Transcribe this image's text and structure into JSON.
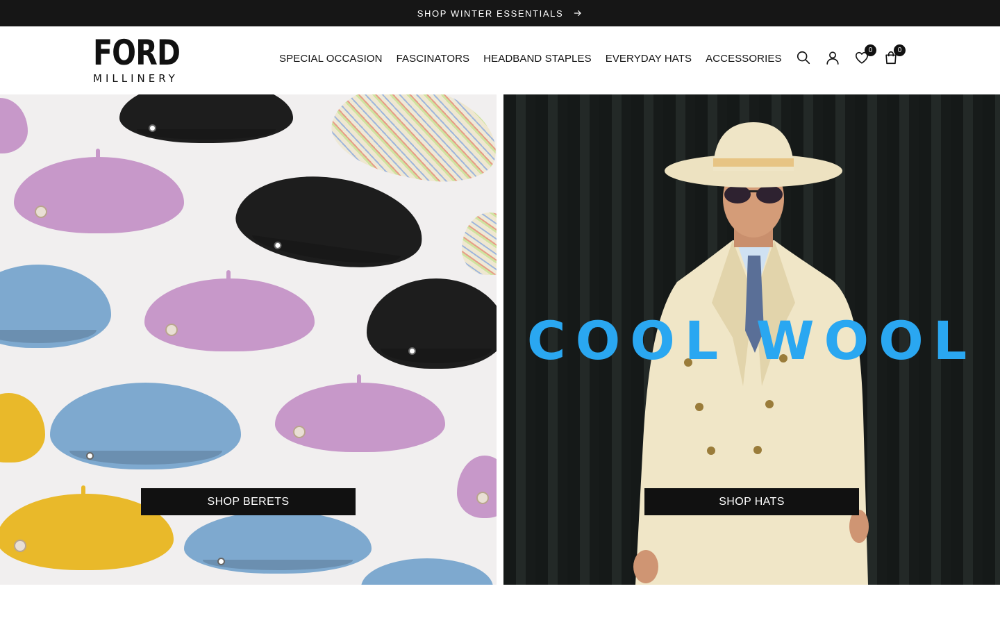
{
  "announcement": {
    "text": "SHOP WINTER ESSENTIALS",
    "icon": "arrow-right-icon"
  },
  "brand": {
    "name": "FORD",
    "subtitle": "MILLINERY"
  },
  "nav": {
    "items": [
      {
        "label": "SPECIAL OCCASION"
      },
      {
        "label": "FASCINATORS"
      },
      {
        "label": "HEADBAND STAPLES"
      },
      {
        "label": "EVERYDAY HATS"
      },
      {
        "label": "ACCESSORIES"
      }
    ]
  },
  "header_icons": {
    "search": "search-icon",
    "account": "user-icon",
    "wishlist": {
      "icon": "heart-icon",
      "count": "0"
    },
    "cart": {
      "icon": "bag-icon",
      "count": "0"
    }
  },
  "hero": {
    "left": {
      "button_label": "SHOP BERETS",
      "image": "berets-collage"
    },
    "right": {
      "headline": "COOL WOOL",
      "button_label": "SHOP HATS",
      "image": "man-in-cream-suit-and-hat"
    }
  },
  "colors": {
    "announcement_bg": "#161616",
    "headline": "#2aa7f1",
    "button_bg": "#111111"
  }
}
